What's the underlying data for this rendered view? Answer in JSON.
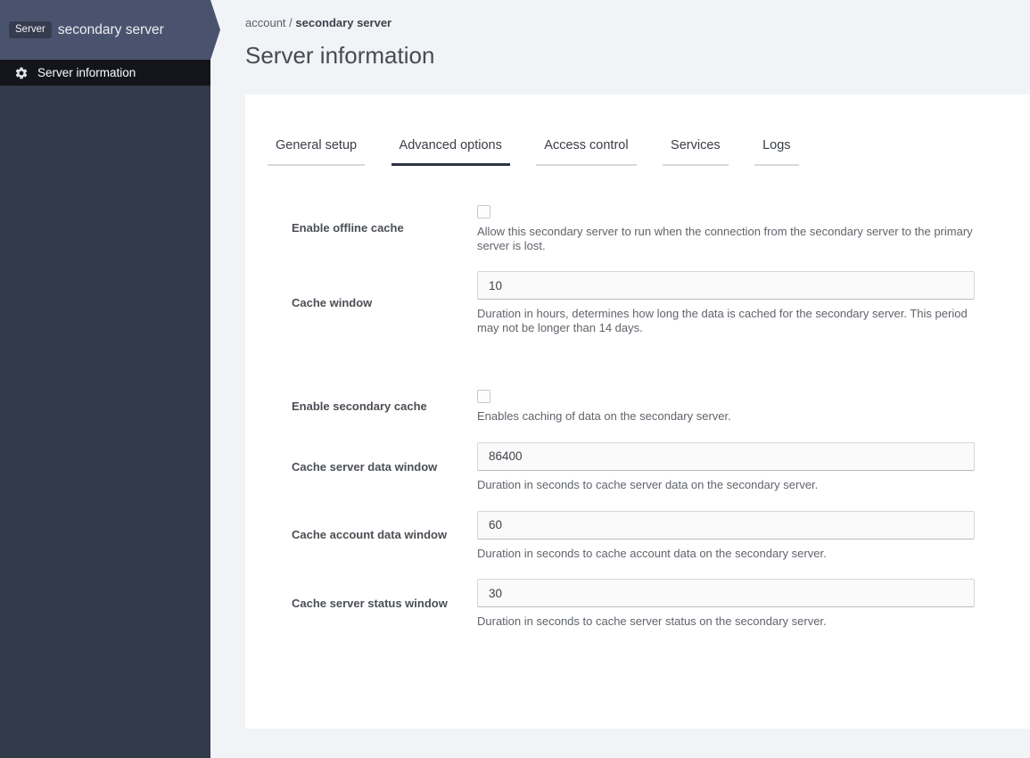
{
  "sidebar": {
    "badge": "Server",
    "title": "secondary server",
    "items": [
      {
        "label": "Server information",
        "icon": "gear-icon",
        "active": true
      }
    ]
  },
  "breadcrumb": {
    "parent": "account",
    "separator": "/",
    "current": "secondary server"
  },
  "page_title": "Server information",
  "tabs": [
    {
      "label": "General setup",
      "active": false
    },
    {
      "label": "Advanced options",
      "active": true
    },
    {
      "label": "Access control",
      "active": false
    },
    {
      "label": "Services",
      "active": false
    },
    {
      "label": "Logs",
      "active": false
    }
  ],
  "form": {
    "fields": [
      {
        "type": "checkbox",
        "label": "Enable offline cache",
        "checked": false,
        "help": "Allow this secondary server to run when the connection from the secondary server to the primary server is lost."
      },
      {
        "type": "text",
        "label": "Cache window",
        "value": "10",
        "help": "Duration in hours, determines how long the data is cached for the secondary server. This period may not be longer than 14 days."
      },
      {
        "type": "checkbox",
        "label": "Enable secondary cache",
        "checked": false,
        "help": "Enables caching of data on the secondary server."
      },
      {
        "type": "text",
        "label": "Cache server data window",
        "value": "86400",
        "help": "Duration in seconds to cache server data on the secondary server."
      },
      {
        "type": "text",
        "label": "Cache account data window",
        "value": "60",
        "help": "Duration in seconds to cache account data on the secondary server."
      },
      {
        "type": "text",
        "label": "Cache server status window",
        "value": "30",
        "help": "Duration in seconds to cache server status on the secondary server."
      }
    ]
  },
  "colors": {
    "page_background": "#f2f3f6",
    "sidebar_background": "#333a49",
    "sidebar_header_background": "#4a536e",
    "sidebar_active_item_background": "#13151b",
    "badge_background": "#353c4d",
    "card_background": "#ffffff",
    "active_tab_underline": "#2d3342",
    "inactive_tab_underline": "#d9d9d9",
    "input_background": "#fafafa"
  }
}
